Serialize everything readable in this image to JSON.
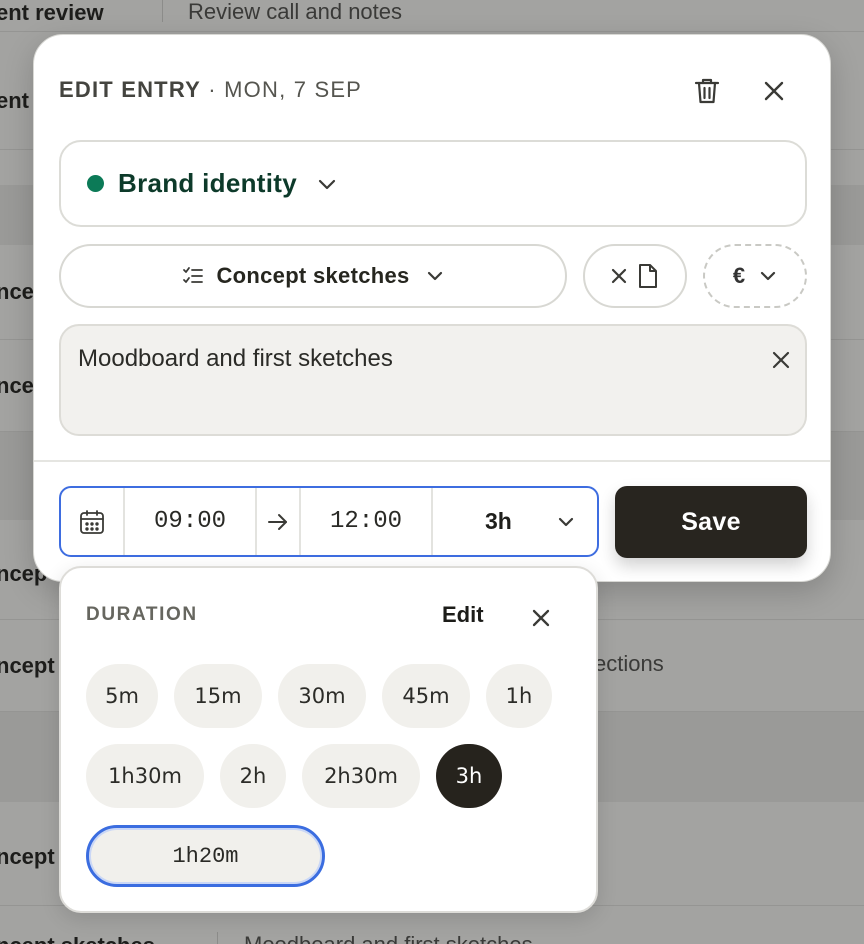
{
  "background_rows": [
    {
      "c1": "ent review",
      "c2": "Review call and notes"
    },
    {
      "c1": "ent",
      "c2": ""
    },
    {
      "c1": "nce",
      "c2": ""
    },
    {
      "c1": "nce",
      "c2": ""
    },
    {
      "c1": "ncep",
      "c2": ""
    },
    {
      "c1": "ncept",
      "c2": "ections"
    },
    {
      "c1": "ncept",
      "c2": ""
    },
    {
      "c1": "ncept sketches",
      "c2": "Moodboard and first sketches"
    }
  ],
  "modal": {
    "title_prefix": "EDIT ENTRY",
    "title_separator": "·",
    "date": "MON, 7 SEP",
    "project": {
      "name": "Brand identity",
      "color": "#0c7a57"
    },
    "task": {
      "label": "Concept sketches"
    },
    "currency_symbol": "€",
    "description": "Moodboard and first sketches",
    "time": {
      "start": "09:00",
      "end": "12:00",
      "duration": "3h"
    },
    "save_label": "Save"
  },
  "duration_popover": {
    "title": "DURATION",
    "edit_label": "Edit",
    "presets": [
      "5m",
      "15m",
      "30m",
      "45m",
      "1h",
      "1h30m",
      "2h",
      "2h30m",
      "3h"
    ],
    "selected": "3h",
    "custom_value": "1h20m"
  },
  "colors": {
    "accent": "#3e6de0",
    "dark": "#28251f",
    "project_dot": "#0c7a57"
  }
}
